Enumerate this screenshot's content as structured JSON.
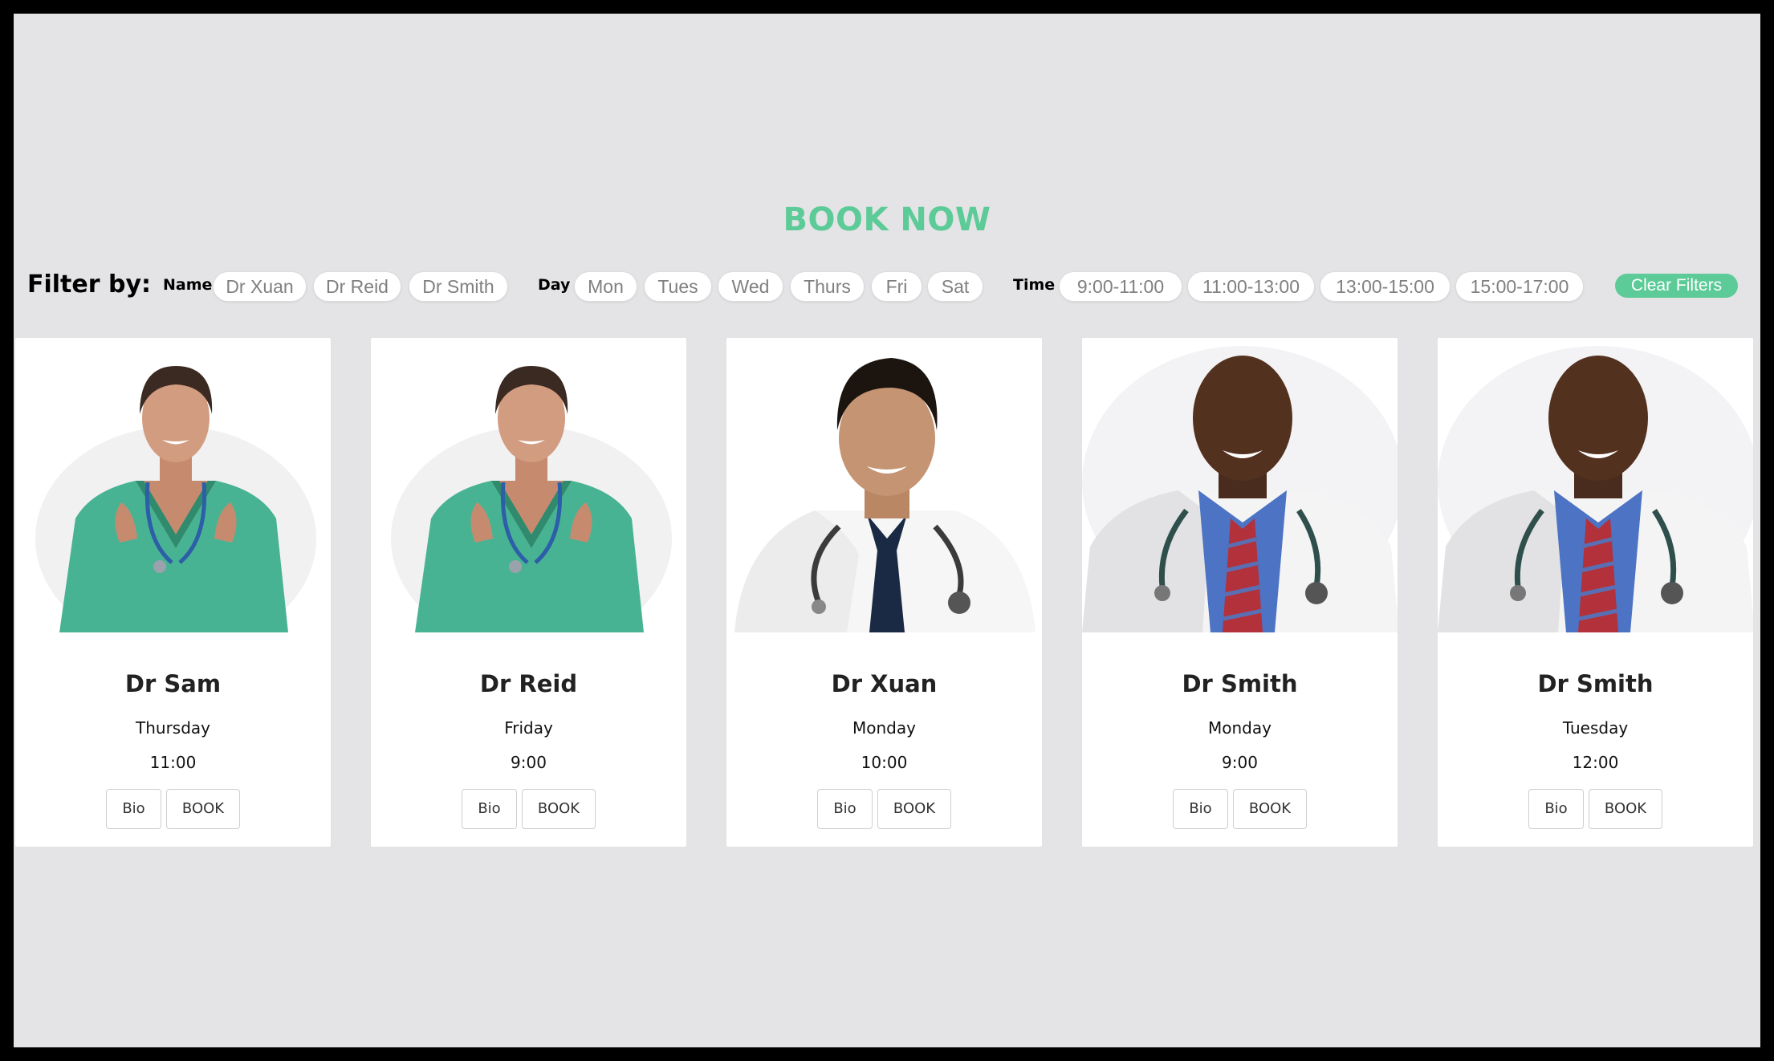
{
  "header": {
    "title": "BOOK NOW"
  },
  "filters": {
    "heading": "Filter by:",
    "name_label": "Name",
    "names": [
      "Dr Xuan",
      "Dr Reid",
      "Dr Smith"
    ],
    "day_label": "Day",
    "days": [
      "Mon",
      "Tues",
      "Wed",
      "Thurs",
      "Fri",
      "Sat"
    ],
    "time_label": "Time",
    "times": [
      "9:00-11:00",
      "11:00-13:00",
      "13:00-15:00",
      "15:00-17:00"
    ],
    "clear_label": "Clear Filters"
  },
  "doctors": [
    {
      "name": "Dr Sam",
      "day": "Thursday",
      "time": "11:00",
      "bio_label": "Bio",
      "book_label": "BOOK",
      "photo": "female-doctor-green-scrubs"
    },
    {
      "name": "Dr Reid",
      "day": "Friday",
      "time": "9:00",
      "bio_label": "Bio",
      "book_label": "BOOK",
      "photo": "female-doctor-green-scrubs"
    },
    {
      "name": "Dr Xuan",
      "day": "Monday",
      "time": "10:00",
      "bio_label": "Bio",
      "book_label": "BOOK",
      "photo": "male-doctor-white-shirt-tie"
    },
    {
      "name": "Dr Smith",
      "day": "Monday",
      "time": "9:00",
      "bio_label": "Bio",
      "book_label": "BOOK",
      "photo": "male-doctor-lab-coat"
    },
    {
      "name": "Dr Smith",
      "day": "Tuesday",
      "time": "12:00",
      "bio_label": "Bio",
      "book_label": "BOOK",
      "photo": "male-doctor-lab-coat"
    }
  ],
  "colors": {
    "accent": "#5ccb98",
    "page_background": "#e4e3e5",
    "frame": "#000000"
  }
}
